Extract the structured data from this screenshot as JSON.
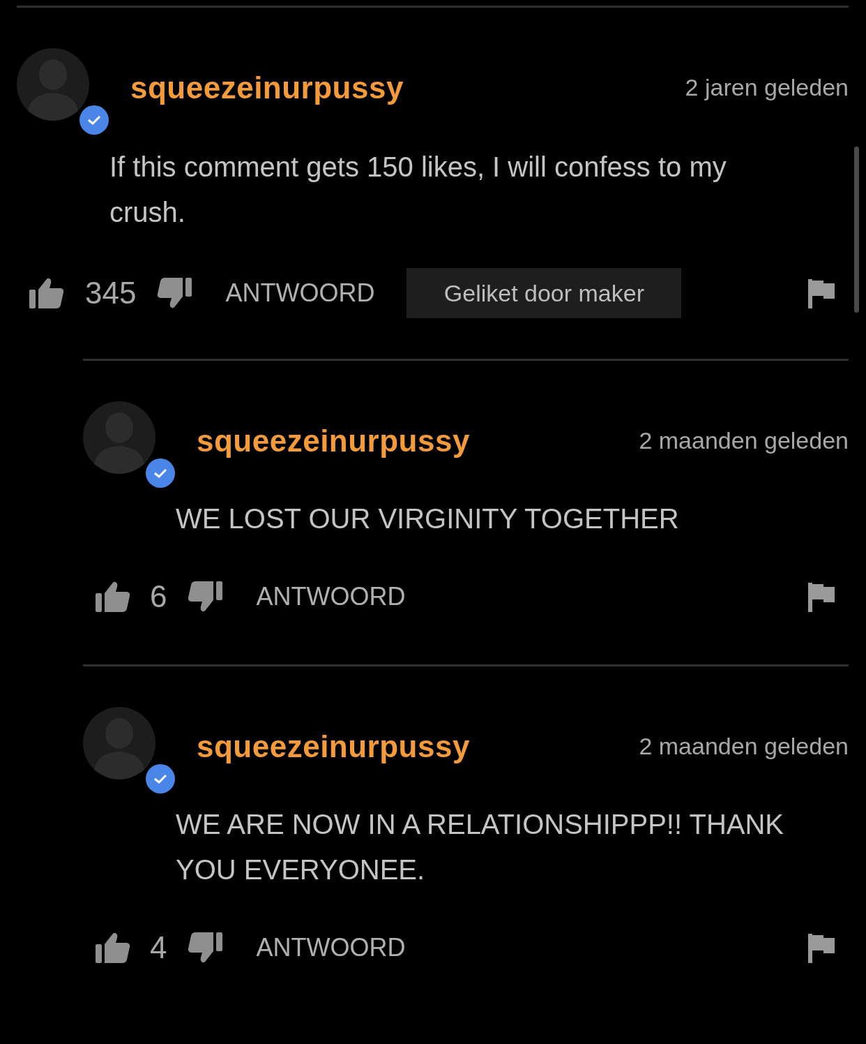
{
  "comments": [
    {
      "username": "squeezeinurpussy",
      "verified": true,
      "time": "2 jaren geleden",
      "text": "If this comment gets 150 likes, I will confess to my crush.",
      "likes": "345",
      "reply_label": "ANTWOORD",
      "creator_like": "Geliket door maker",
      "replies": [
        {
          "username": "squeezeinurpussy",
          "verified": true,
          "time": "2 maanden geleden",
          "text": "WE LOST OUR VIRGINITY TOGETHER",
          "likes": "6",
          "reply_label": "ANTWOORD"
        },
        {
          "username": "squeezeinurpussy",
          "verified": true,
          "time": "2 maanden geleden",
          "text": "WE ARE NOW IN A RELATIONSHIPPP!! THANK YOU EVERYONEE.",
          "likes": "4",
          "reply_label": "ANTWOORD"
        }
      ]
    }
  ]
}
